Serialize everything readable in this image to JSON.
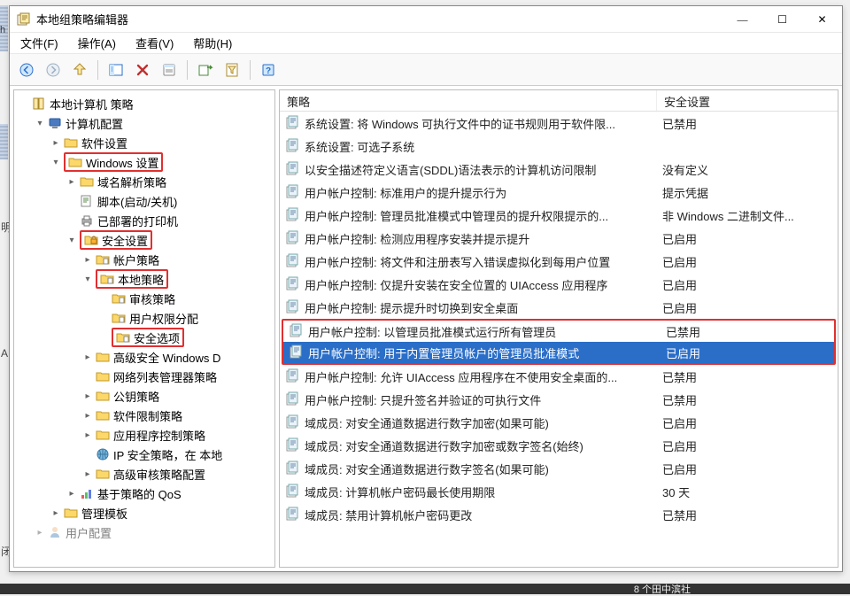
{
  "window": {
    "title": "本地组策略编辑器"
  },
  "menu": {
    "file": "文件(F)",
    "action": "操作(A)",
    "view": "查看(V)",
    "help": "帮助(H)"
  },
  "tree": {
    "root": "本地计算机 策略",
    "computer_cfg": "计算机配置",
    "software": "软件设置",
    "windows_settings": "Windows 设置",
    "dns_policy": "域名解析策略",
    "scripts": "脚本(启动/关机)",
    "printers": "已部署的打印机",
    "security_settings": "安全设置",
    "account_policy": "帐户策略",
    "local_policies": "本地策略",
    "audit_policy": "审核策略",
    "user_rights": "用户权限分配",
    "security_options": "安全选项",
    "adv_sec": "高级安全 Windows D",
    "net_list": "网络列表管理器策略",
    "pubkey": "公钥策略",
    "sw_restrict": "软件限制策略",
    "app_ctrl": "应用程序控制策略",
    "ipsec": "IP 安全策略，在 本地",
    "adv_audit": "高级审核策略配置",
    "qos": "基于策略的 QoS",
    "admin_tmpl": "管理模板",
    "user_cfg_partial": "用户配置"
  },
  "list": {
    "header_policy": "策略",
    "header_setting": "安全设置",
    "rows": [
      {
        "p": "系统设置: 将 Windows 可执行文件中的证书规则用于软件限...",
        "s": "已禁用"
      },
      {
        "p": "系统设置: 可选子系统",
        "s": ""
      },
      {
        "p": "以安全描述符定义语言(SDDL)语法表示的计算机访问限制",
        "s": "没有定义"
      },
      {
        "p": "用户帐户控制: 标准用户的提升提示行为",
        "s": "提示凭据"
      },
      {
        "p": "用户帐户控制: 管理员批准模式中管理员的提升权限提示的...",
        "s": "非 Windows 二进制文件..."
      },
      {
        "p": "用户帐户控制: 检测应用程序安装并提示提升",
        "s": "已启用"
      },
      {
        "p": "用户帐户控制: 将文件和注册表写入错误虚拟化到每用户位置",
        "s": "已启用"
      },
      {
        "p": "用户帐户控制: 仅提升安装在安全位置的 UIAccess 应用程序",
        "s": "已启用"
      },
      {
        "p": "用户帐户控制: 提示提升时切换到安全桌面",
        "s": "已启用"
      },
      {
        "p": "用户帐户控制: 以管理员批准模式运行所有管理员",
        "s": "已禁用"
      },
      {
        "p": "用户帐户控制: 用于内置管理员帐户的管理员批准模式",
        "s": "已启用"
      },
      {
        "p": "用户帐户控制: 允许 UIAccess 应用程序在不使用安全桌面的...",
        "s": "已禁用"
      },
      {
        "p": "用户帐户控制: 只提升签名并验证的可执行文件",
        "s": "已禁用"
      },
      {
        "p": "域成员: 对安全通道数据进行数字加密(如果可能)",
        "s": "已启用"
      },
      {
        "p": "域成员: 对安全通道数据进行数字加密或数字签名(始终)",
        "s": "已启用"
      },
      {
        "p": "域成员: 对安全通道数据进行数字签名(如果可能)",
        "s": "已启用"
      },
      {
        "p": "域成员: 计算机帐户密码最长使用期限",
        "s": "30 天"
      },
      {
        "p": "域成员: 禁用计算机帐户密码更改",
        "s": "已禁用"
      }
    ]
  },
  "bottom_text": "8 个田中滨社"
}
